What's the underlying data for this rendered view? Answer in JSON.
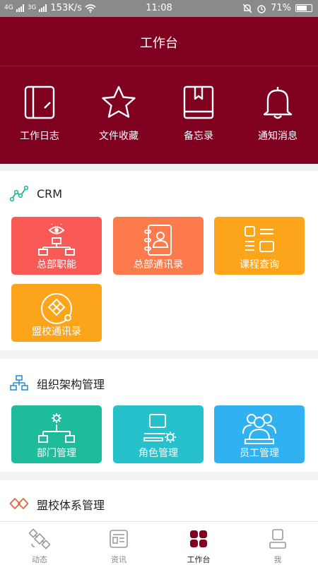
{
  "status_bar": {
    "signal_left": "4G",
    "signal_right": "3G",
    "speed": "153K/s",
    "time": "11:08",
    "battery": "71%",
    "battery_level": 0.71
  },
  "header": {
    "title": "工作台",
    "quick_actions": [
      {
        "label": "工作日志",
        "icon": "notebook-icon"
      },
      {
        "label": "文件收藏",
        "icon": "star-icon"
      },
      {
        "label": "备忘录",
        "icon": "book-icon"
      },
      {
        "label": "通知消息",
        "icon": "bell-icon"
      }
    ]
  },
  "sections": {
    "crm": {
      "title": "CRM",
      "tiles": [
        {
          "label": "总部职能",
          "color": "#fa5a55"
        },
        {
          "label": "总部通讯录",
          "color": "#fc7a4c"
        },
        {
          "label": "课程查询",
          "color": "#fca51b"
        },
        {
          "label": "盟校通讯录",
          "color": "#fca51b"
        }
      ]
    },
    "org": {
      "title": "组织架构管理",
      "tiles": [
        {
          "label": "部门管理",
          "color": "#1cbc9c"
        },
        {
          "label": "角色管理",
          "color": "#27c1cc"
        },
        {
          "label": "员工管理",
          "color": "#2fb1f2"
        }
      ]
    },
    "league": {
      "title": "盟校体系管理"
    }
  },
  "tabbar": {
    "tabs": [
      {
        "label": "动态"
      },
      {
        "label": "资讯"
      },
      {
        "label": "工作台"
      },
      {
        "label": "我"
      }
    ],
    "active_color": "#800020"
  }
}
